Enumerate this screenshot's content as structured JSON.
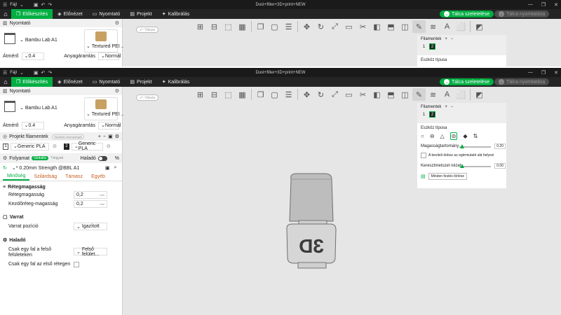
{
  "app": {
    "title": "Dust+filter+3D+print+NEW",
    "menu": "Fájl"
  },
  "tabs": [
    {
      "label": "Előkészítés"
    },
    {
      "label": "Előnézet"
    },
    {
      "label": "Nyomtató"
    },
    {
      "label": "Projekt"
    },
    {
      "label": "Kalibrálás"
    }
  ],
  "actions": {
    "slice": "Tálca szeletelése",
    "print": "Tálca nyomtatása"
  },
  "printer": {
    "section": "Nyomtató",
    "name": "Bambu Lab A1",
    "plate": "Textured PEI ...",
    "nozzle_label": "Átmérő",
    "nozzle_value": "0.4",
    "flow_label": "Anyagáramlás",
    "flow_value": "Normál"
  },
  "filaments": {
    "section": "Projekt filamentek",
    "hint": "Tisztítási mennyiségek",
    "items": [
      {
        "index": "1",
        "name": "Generic PLA"
      },
      {
        "index": "2",
        "name": "Generic PLA"
      }
    ]
  },
  "process": {
    "label": "Folyamat",
    "global": "Globális",
    "object": "Tárgyak",
    "advanced": "Haladó",
    "profile": "* 0.20mm Strength @BBL A1",
    "tabs": [
      "Minőség",
      "Szilárdság",
      "Támasz",
      "Egyéb"
    ]
  },
  "settings": {
    "layer_group": "Rétegmagasság",
    "layer_height_label": "Rétegmagasság",
    "layer_height_value": "0,2",
    "first_layer_label": "Kezdőréteg-magasság",
    "first_layer_value": "0,2",
    "unit": "mm",
    "seam_group": "Varrat",
    "seam_pos_label": "Varrat pozíció",
    "seam_pos_value": "Igazított",
    "adv_group": "Haladó",
    "one_wall_top_label": "Csak egy fal a felső felületeken",
    "one_wall_top_value": "Felső felület...",
    "one_wall_first_label": "Csak egy fal az első rétegen"
  },
  "canvas": {
    "back": "Vissza"
  },
  "filament_panel": {
    "title": "Filamentek",
    "chip1": "1",
    "chip2": "2",
    "tool_type": "Eszköz típusa",
    "height_range": "Magasságtartomány",
    "height_value": "0.20",
    "checkbox_label": "A beviteli doboz az egérmutató alá helyezi",
    "cross_section": "Keresztmetszet nézet",
    "cross_value": "0.00",
    "clear_button": "Minden festés törlése"
  },
  "colors": {
    "accent": "#00ae42",
    "dark_bar": "#1a1a1a",
    "tab_bar": "#242424"
  }
}
